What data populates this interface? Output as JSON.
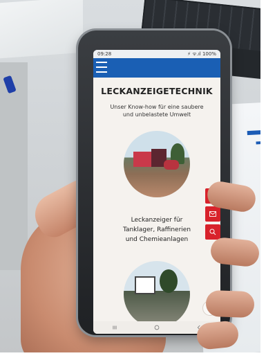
{
  "status_bar": {
    "time": "09:28",
    "indicators": "⚡ ᯤ.ıl 100%"
  },
  "header": {
    "menu_icon": "hamburger-icon",
    "brand_color": "#1a5fb4"
  },
  "hero": {
    "title": "LECKANZEIGETECHNIK",
    "subtitle_line1": "Unser Know-how für eine saubere",
    "subtitle_line2": "und unbelastete Umwelt"
  },
  "section1": {
    "caption_line1": "Leckanzeiger für",
    "caption_line2": "Tanklager, Raffinerien",
    "caption_line3": "und Chemieanlagen"
  },
  "actions": {
    "color": "#d8222b",
    "icons": [
      "phone-icon",
      "mail-icon",
      "search-icon"
    ]
  },
  "scroll_top_icon": "chevron-up-icon",
  "system_nav": {
    "icons": [
      "recent-apps-icon",
      "home-icon",
      "back-icon"
    ]
  }
}
